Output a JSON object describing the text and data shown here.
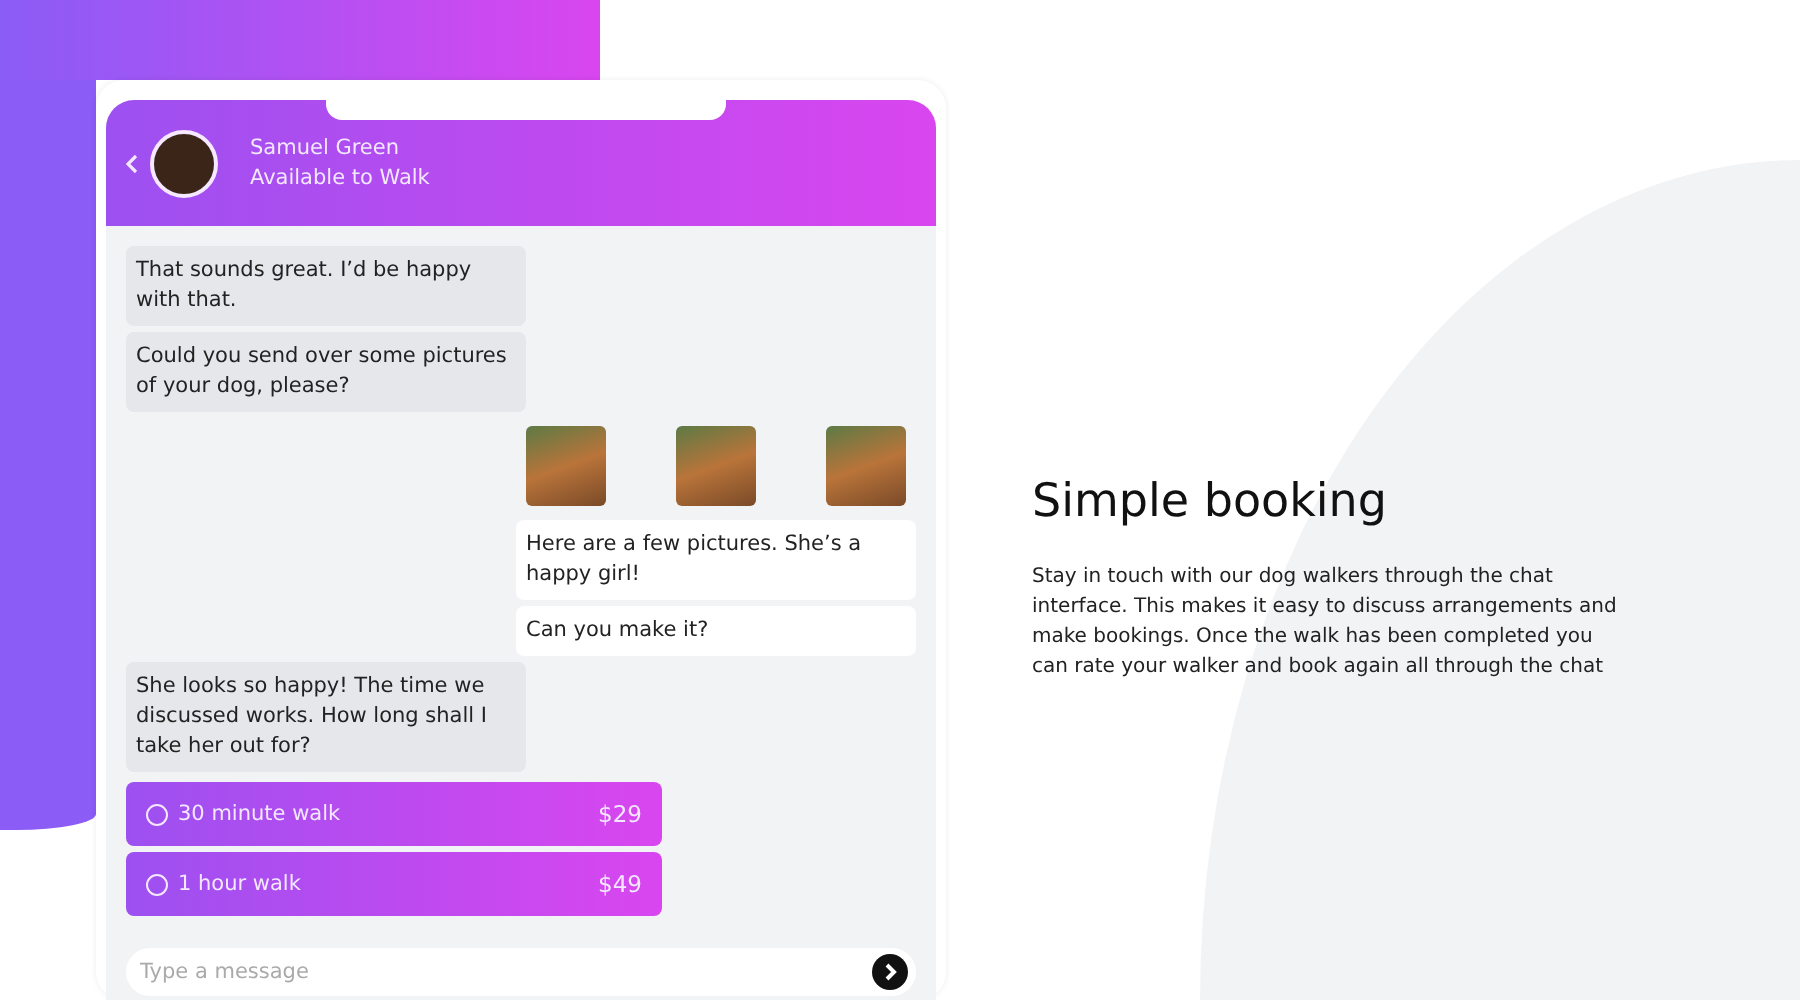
{
  "chat": {
    "contact": {
      "name": "Samuel Green",
      "status": "Available to Walk"
    },
    "messages": [
      {
        "kind": "received",
        "text": "That sounds great. I’d be happy with that."
      },
      {
        "kind": "received",
        "text": "Could you send over some pictures of your dog, please?"
      },
      {
        "kind": "images",
        "photos": [
          {
            "kind": "photo"
          },
          {
            "kind": "photo"
          },
          {
            "kind": "photo"
          }
        ]
      },
      {
        "kind": "sent",
        "text": "Here are a few pictures. She’s a happy girl!"
      },
      {
        "kind": "sent",
        "text": "Can you make it?"
      },
      {
        "kind": "received",
        "text": "She looks so happy! The time we discussed works. How long shall I take her out for?"
      },
      {
        "kind": "options",
        "options": [
          {
            "label": "30 minute walk",
            "price": "$29",
            "selected": false
          },
          {
            "label": "1 hour walk",
            "price": "$49",
            "selected": false
          }
        ]
      }
    ],
    "composer": {
      "placeholder": "Type a message"
    }
  },
  "feature": {
    "title": "Simple booking",
    "body": "Stay in touch with our dog walkers through the chat interface. This makes it easy to discuss arrangements and make bookings. Once the walk has been completed you can rate your walker and book again all through the chat"
  }
}
